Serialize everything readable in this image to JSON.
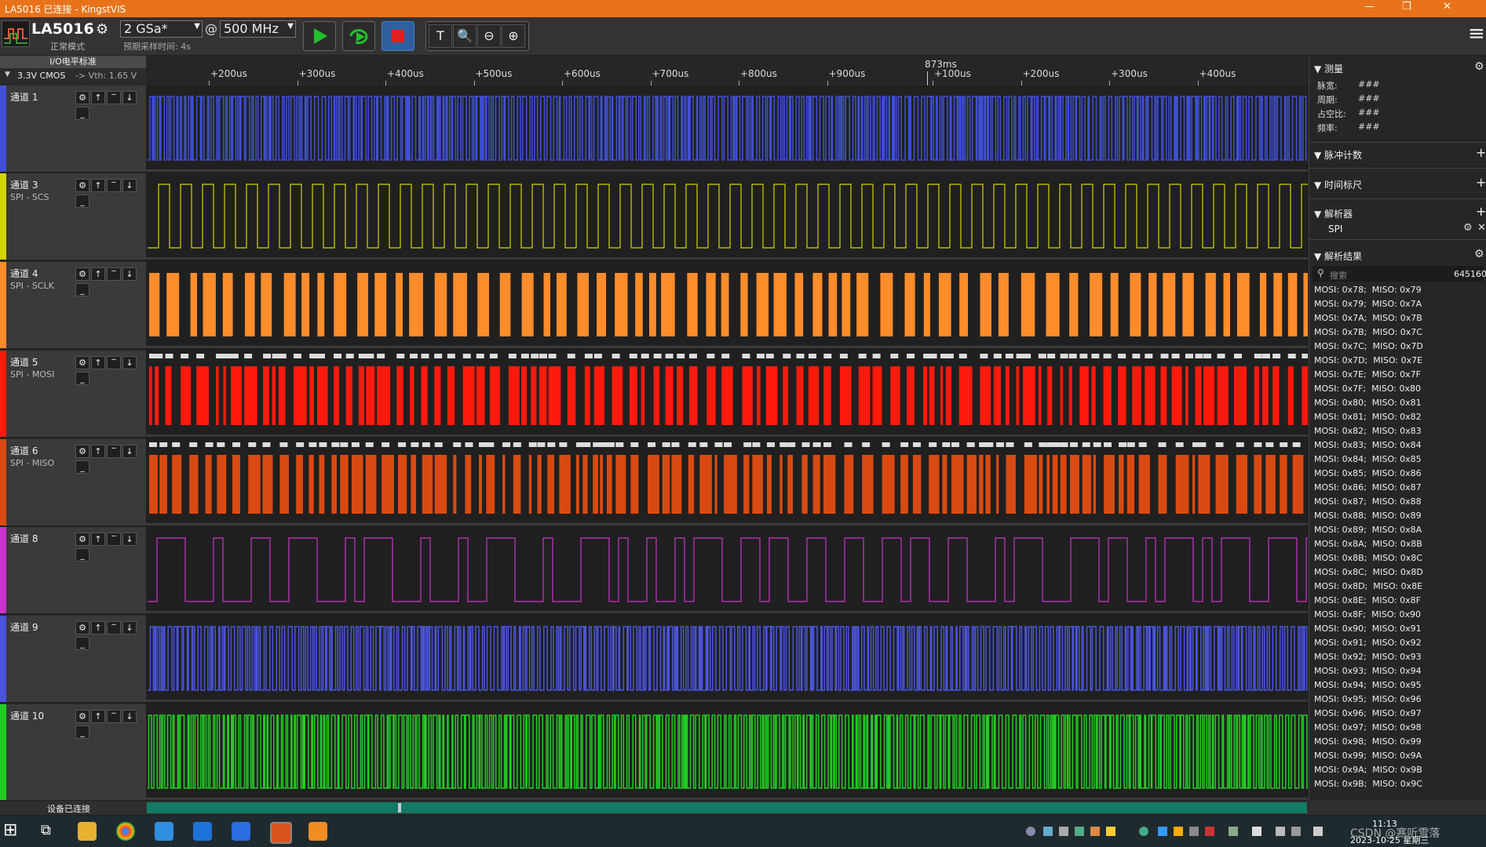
{
  "window": {
    "title": "LA5016 已连接 - KingstVIS"
  },
  "device": {
    "name": "LA5016",
    "mode": "正常模式"
  },
  "toolbar": {
    "sample_rate": "2 GSa*",
    "at": "@",
    "frequency": "500 MHz",
    "estimated_time": "预期采样时间: 4s"
  },
  "io_standard": {
    "title": "I/O电平标准",
    "value": "3.3V CMOS",
    "vth": "-> Vth: 1.65 V"
  },
  "channels": [
    {
      "label": "通道 1",
      "sub": "",
      "color": "#3f50d6"
    },
    {
      "label": "通道 3",
      "sub": "SPI - SCS",
      "color": "#d4d400"
    },
    {
      "label": "通道 4",
      "sub": "SPI - SCLK",
      "color": "#ff8c2a"
    },
    {
      "label": "通道 5",
      "sub": "SPI - MOSI",
      "color": "#ff1a0d"
    },
    {
      "label": "通道 6",
      "sub": "SPI - MISO",
      "color": "#d94a12"
    },
    {
      "label": "通道 8",
      "sub": "",
      "color": "#cc33cc"
    },
    {
      "label": "通道 9",
      "sub": "",
      "color": "#4a55dd"
    },
    {
      "label": "通道 10",
      "sub": "",
      "color": "#22cc22"
    }
  ],
  "ruler": {
    "center": "873ms",
    "ticks": [
      "+200us",
      "+300us",
      "+400us",
      "+500us",
      "+600us",
      "+700us",
      "+800us",
      "+900us",
      "+100us",
      "+200us",
      "+300us",
      "+400us"
    ]
  },
  "right_panel": {
    "measure": {
      "title": "测量",
      "rows": [
        {
          "k": "脉宽:",
          "v": "###"
        },
        {
          "k": "周期:",
          "v": "###"
        },
        {
          "k": "占空比:",
          "v": "###"
        },
        {
          "k": "频率:",
          "v": "###"
        }
      ]
    },
    "pulse_count": "脉冲计数",
    "time_ruler": "时间标尺",
    "analyzer": {
      "title": "解析器",
      "item": "SPI"
    },
    "results": {
      "title": "解析结果",
      "search_placeholder": "搜索",
      "count": "645160"
    },
    "result_rows": [
      "MOSI: 0x78;  MISO: 0x79",
      "MOSI: 0x79;  MISO: 0x7A",
      "MOSI: 0x7A;  MISO: 0x7B",
      "MOSI: 0x7B;  MISO: 0x7C",
      "MOSI: 0x7C;  MISO: 0x7D",
      "MOSI: 0x7D;  MISO: 0x7E",
      "MOSI: 0x7E;  MISO: 0x7F",
      "MOSI: 0x7F;  MISO: 0x80",
      "MOSI: 0x80;  MISO: 0x81",
      "MOSI: 0x81;  MISO: 0x82",
      "MOSI: 0x82;  MISO: 0x83",
      "MOSI: 0x83;  MISO: 0x84",
      "MOSI: 0x84;  MISO: 0x85",
      "MOSI: 0x85;  MISO: 0x86",
      "MOSI: 0x86;  MISO: 0x87",
      "MOSI: 0x87;  MISO: 0x88",
      "MOSI: 0x88;  MISO: 0x89",
      "MOSI: 0x89;  MISO: 0x8A",
      "MOSI: 0x8A;  MISO: 0x8B",
      "MOSI: 0x8B;  MISO: 0x8C",
      "MOSI: 0x8C;  MISO: 0x8D",
      "MOSI: 0x8D;  MISO: 0x8E",
      "MOSI: 0x8E;  MISO: 0x8F",
      "MOSI: 0x8F;  MISO: 0x90",
      "MOSI: 0x90;  MISO: 0x91",
      "MOSI: 0x91;  MISO: 0x92",
      "MOSI: 0x92;  MISO: 0x93",
      "MOSI: 0x93;  MISO: 0x94",
      "MOSI: 0x94;  MISO: 0x95",
      "MOSI: 0x95;  MISO: 0x96",
      "MOSI: 0x96;  MISO: 0x97",
      "MOSI: 0x97;  MISO: 0x98",
      "MOSI: 0x98;  MISO: 0x99",
      "MOSI: 0x99;  MISO: 0x9A",
      "MOSI: 0x9A;  MISO: 0x9B",
      "MOSI: 0x9B;  MISO: 0x9C"
    ]
  },
  "status": {
    "device": "设备已连接"
  },
  "taskbar": {
    "time": "11:13",
    "date": "2023-10-25 星期三",
    "watermark": "CSDN @寒听雪落"
  }
}
